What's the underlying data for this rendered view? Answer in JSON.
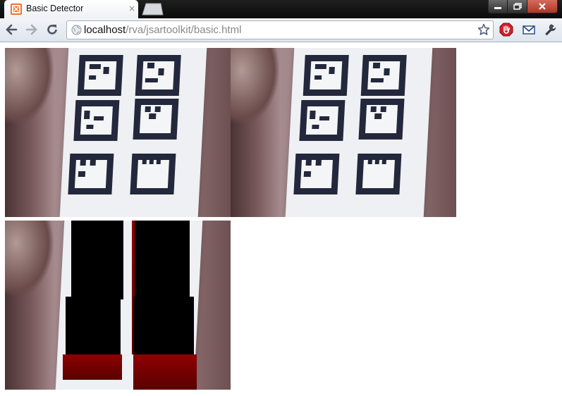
{
  "browser": {
    "tab_title": "Basic Detector",
    "tab_close": "×",
    "url_host": "localhost",
    "url_path": "/rva/jsartoolkit/basic.html",
    "icons": [
      "back-arrow-icon",
      "forward-arrow-icon",
      "reload-icon",
      "globe-icon",
      "star-icon",
      "adblock-icon",
      "mail-icon",
      "wrench-icon",
      "minimize-icon",
      "maximize-icon",
      "close-icon"
    ]
  },
  "page": {
    "canvases": [
      "video-canvas",
      "debug-canvas",
      "augmented-canvas"
    ]
  },
  "colors": {
    "marker": "#23283c",
    "paper": "#eef0f3",
    "cube_face": "#000000",
    "cube_side": "#8e0000"
  }
}
